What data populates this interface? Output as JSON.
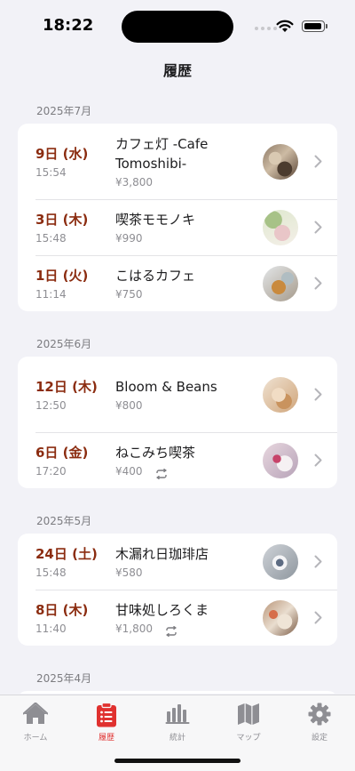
{
  "status": {
    "time": "18:22"
  },
  "nav": {
    "title": "履歴"
  },
  "colors": {
    "accent": "#8b2c10",
    "tab_active": "#e0312f",
    "tab_inactive": "#8e8e93"
  },
  "sections": [
    {
      "header": "2025年7月",
      "rows": [
        {
          "day": "9日 (水)",
          "time": "15:54",
          "name": "カフェ灯 -Cafe Tomoshibi-",
          "price": "¥3,800",
          "repeat": false,
          "thumb": "cafe-interior"
        },
        {
          "day": "3日 (木)",
          "time": "15:48",
          "name": "喫茶モモノキ",
          "price": "¥990",
          "repeat": false,
          "thumb": "bubble-tea"
        },
        {
          "day": "1日 (火)",
          "time": "11:14",
          "name": "こはるカフェ",
          "price": "¥750",
          "repeat": false,
          "thumb": "iced-tea"
        }
      ]
    },
    {
      "header": "2025年6月",
      "rows": [
        {
          "day": "12日 (木)",
          "time": "12:50",
          "name": "Bloom & Beans",
          "price": "¥800",
          "repeat": false,
          "thumb": "latte"
        },
        {
          "day": "6日 (金)",
          "time": "17:20",
          "name": "ねこみち喫茶",
          "price": "¥400",
          "repeat": true,
          "thumb": "berry-dessert"
        }
      ]
    },
    {
      "header": "2025年5月",
      "rows": [
        {
          "day": "24日 (土)",
          "time": "15:48",
          "name": "木漏れ日珈琲店",
          "price": "¥580",
          "repeat": false,
          "thumb": "coffee-cup"
        },
        {
          "day": "8日 (木)",
          "time": "11:40",
          "name": "甘味処しろくま",
          "price": "¥1,800",
          "repeat": true,
          "thumb": "sweets-table"
        }
      ]
    },
    {
      "header": "2025年4月",
      "rows": []
    }
  ],
  "tabs": [
    {
      "label": "ホーム",
      "icon": "house-icon",
      "active": false
    },
    {
      "label": "履歴",
      "icon": "clipboard-list-icon",
      "active": true
    },
    {
      "label": "統計",
      "icon": "bar-chart-icon",
      "active": false
    },
    {
      "label": "マップ",
      "icon": "map-icon",
      "active": false
    },
    {
      "label": "設定",
      "icon": "gear-icon",
      "active": false
    }
  ]
}
